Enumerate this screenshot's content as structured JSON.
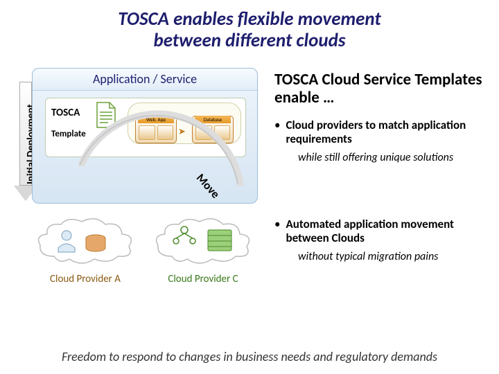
{
  "title_line1": "TOSCA enables flexible movement",
  "title_line2": "between different clouds",
  "initial_deployment_label": "Initial Deployment",
  "app_panel_header": "Application / Service",
  "tosca_label": "TOSCA",
  "template_label": "Template",
  "node_webapp": "Web. App",
  "node_database": "Database",
  "move_label": "Move",
  "right_title": "TOSCA Cloud Service Templates enable …",
  "bullet1_bold": "Cloud providers to match application requirements",
  "bullet1_sub": "while still offering unique solutions",
  "bullet2_bold": "Automated application movement between Clouds",
  "bullet2_sub": "without typical migration pains",
  "cloud_provider_a": "Cloud Provider A",
  "cloud_provider_c": "Cloud Provider C",
  "bottom_tagline": "Freedom to respond to changes in business needs and regulatory demands"
}
